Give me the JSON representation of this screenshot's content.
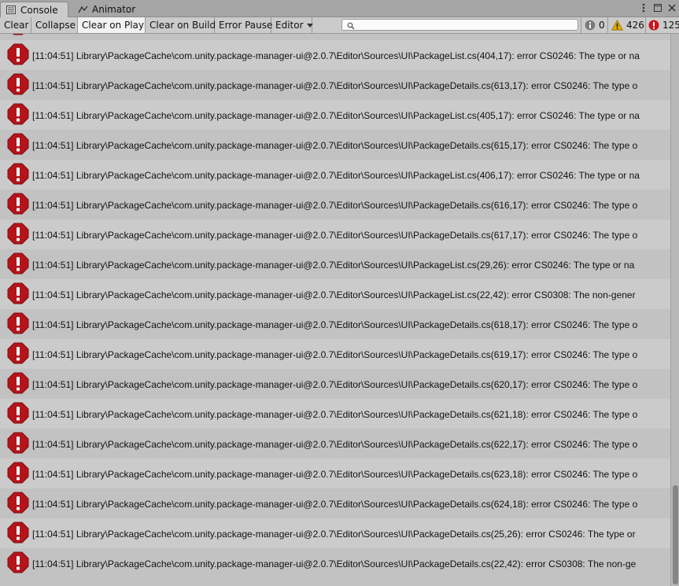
{
  "tabs": {
    "console": "Console",
    "animator": "Animator"
  },
  "toolbar": {
    "clear": "Clear",
    "collapse": "Collapse",
    "clear_on_play": "Clear on Play",
    "clear_on_build": "Clear on Build",
    "error_pause": "Error Pause",
    "editor": "Editor",
    "info_count": "0",
    "warning_count": "426",
    "error_count": "125"
  },
  "colors": {
    "error_red": "#b4141a",
    "warning_yellow": "#e0a800",
    "active_toggle": "#f2f2f2"
  },
  "icons": {
    "info": "info-icon",
    "warning": "warning-icon",
    "error": "error-icon",
    "search": "search-icon",
    "menu": "kebab-menu-icon",
    "close": "close-icon"
  },
  "logs": [
    "[11:04:51] Library\\PackageCache\\com.unity.package-manager-ui@2.0.7\\Editor\\Sources\\UI\\PackageList.cs(404,17): error CS0246: The type or na",
    "[11:04:51] Library\\PackageCache\\com.unity.package-manager-ui@2.0.7\\Editor\\Sources\\UI\\PackageDetails.cs(613,17): error CS0246: The type o",
    "[11:04:51] Library\\PackageCache\\com.unity.package-manager-ui@2.0.7\\Editor\\Sources\\UI\\PackageList.cs(405,17): error CS0246: The type or na",
    "[11:04:51] Library\\PackageCache\\com.unity.package-manager-ui@2.0.7\\Editor\\Sources\\UI\\PackageDetails.cs(615,17): error CS0246: The type o",
    "[11:04:51] Library\\PackageCache\\com.unity.package-manager-ui@2.0.7\\Editor\\Sources\\UI\\PackageList.cs(406,17): error CS0246: The type or na",
    "[11:04:51] Library\\PackageCache\\com.unity.package-manager-ui@2.0.7\\Editor\\Sources\\UI\\PackageDetails.cs(616,17): error CS0246: The type o",
    "[11:04:51] Library\\PackageCache\\com.unity.package-manager-ui@2.0.7\\Editor\\Sources\\UI\\PackageDetails.cs(617,17): error CS0246: The type o",
    "[11:04:51] Library\\PackageCache\\com.unity.package-manager-ui@2.0.7\\Editor\\Sources\\UI\\PackageList.cs(29,26): error CS0246: The type or na",
    "[11:04:51] Library\\PackageCache\\com.unity.package-manager-ui@2.0.7\\Editor\\Sources\\UI\\PackageList.cs(22,42): error CS0308: The non-gener",
    "[11:04:51] Library\\PackageCache\\com.unity.package-manager-ui@2.0.7\\Editor\\Sources\\UI\\PackageDetails.cs(618,17): error CS0246: The type o",
    "[11:04:51] Library\\PackageCache\\com.unity.package-manager-ui@2.0.7\\Editor\\Sources\\UI\\PackageDetails.cs(619,17): error CS0246: The type o",
    "[11:04:51] Library\\PackageCache\\com.unity.package-manager-ui@2.0.7\\Editor\\Sources\\UI\\PackageDetails.cs(620,17): error CS0246: The type o",
    "[11:04:51] Library\\PackageCache\\com.unity.package-manager-ui@2.0.7\\Editor\\Sources\\UI\\PackageDetails.cs(621,18): error CS0246: The type o",
    "[11:04:51] Library\\PackageCache\\com.unity.package-manager-ui@2.0.7\\Editor\\Sources\\UI\\PackageDetails.cs(622,17): error CS0246: The type o",
    "[11:04:51] Library\\PackageCache\\com.unity.package-manager-ui@2.0.7\\Editor\\Sources\\UI\\PackageDetails.cs(623,18): error CS0246: The type o",
    "[11:04:51] Library\\PackageCache\\com.unity.package-manager-ui@2.0.7\\Editor\\Sources\\UI\\PackageDetails.cs(624,18): error CS0246: The type o",
    "[11:04:51] Library\\PackageCache\\com.unity.package-manager-ui@2.0.7\\Editor\\Sources\\UI\\PackageDetails.cs(25,26): error CS0246: The type or",
    "[11:04:51] Library\\PackageCache\\com.unity.package-manager-ui@2.0.7\\Editor\\Sources\\UI\\PackageDetails.cs(22,42): error CS0308: The non-ge"
  ]
}
